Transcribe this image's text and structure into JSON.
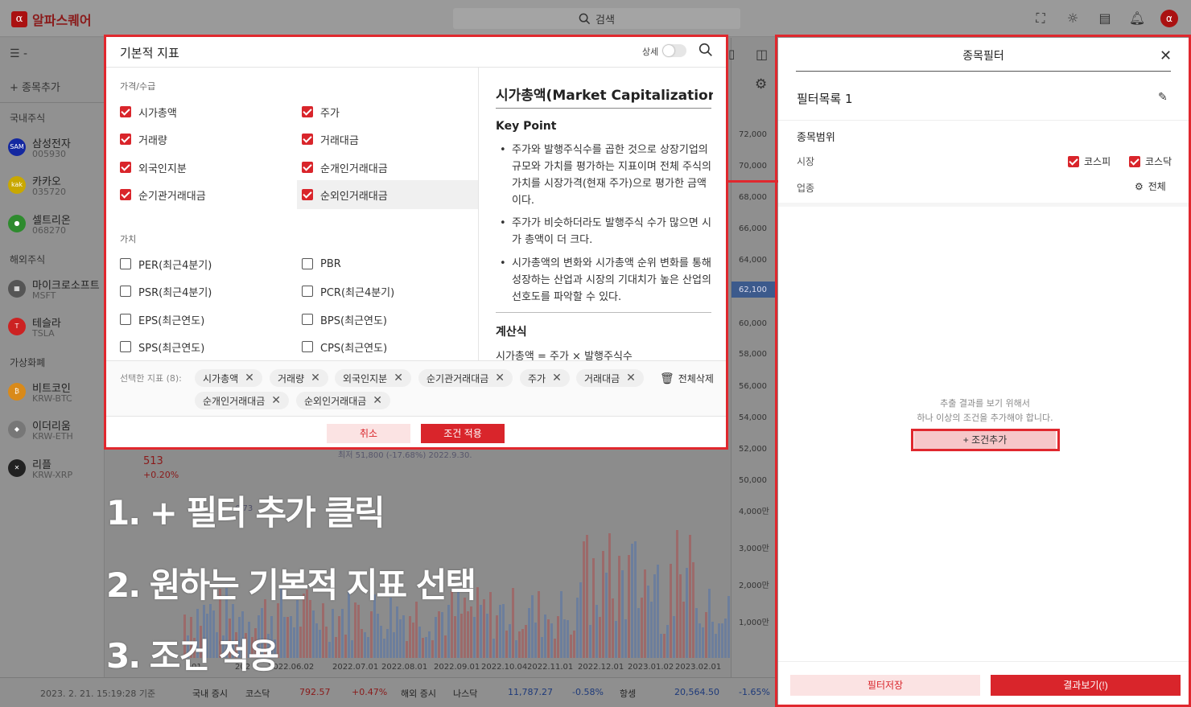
{
  "app": {
    "name": "알파스퀘어",
    "logo_letter": "α",
    "search_placeholder": "검색"
  },
  "colors": {
    "accent": "#d9252b",
    "highlight_frame": "#e0282e"
  },
  "sidebar": {
    "menu_label": "☰ -",
    "add_label": "+ 종목추가",
    "sections": [
      "국내주식",
      "해외주식",
      "가상화폐"
    ],
    "stocks": [
      {
        "name": "삼성전자",
        "code": "005930",
        "icon": "samsung-icon",
        "color": "#1428a0"
      },
      {
        "name": "카카오",
        "code": "035720",
        "icon": "kakao-icon",
        "color": "#c9a800"
      },
      {
        "name": "셀트리온",
        "code": "068270",
        "icon": "celltrion-icon",
        "color": "#2e8b2e"
      },
      {
        "name": "마이크로소프트",
        "code": "MSFT",
        "icon": "microsoft-icon",
        "color": "#555"
      },
      {
        "name": "테슬라",
        "code": "TSLA",
        "icon": "tesla-icon",
        "color": "#c22"
      },
      {
        "name": "비트코인",
        "code": "KRW-BTC",
        "icon": "bitcoin-icon",
        "color": "#d98a1a"
      },
      {
        "name": "이더리움",
        "code": "KRW-ETH",
        "icon": "ethereum-icon",
        "color": "#777"
      },
      {
        "name": "리플",
        "code": "KRW-XRP",
        "icon": "ripple-icon",
        "color": "#222"
      }
    ],
    "ripple_price": "513",
    "ripple_change": "+0.20%"
  },
  "chart": {
    "yticks": [
      "72,000",
      "70,000",
      "68,000",
      "66,000",
      "64,000",
      "62,100",
      "60,000",
      "58,000",
      "56,000",
      "54,000",
      "52,000",
      "50,000",
      "4,000만",
      "3,000만",
      "2,000만",
      "1,000만"
    ],
    "xticks": [
      "01",
      "202",
      "2022.06.02",
      "2022.07.01",
      "2022.08.01",
      "2022.09.01",
      "2022.10.04",
      "2022.11.01",
      "2022.12.01",
      "2023.01.02",
      "2023.02.01"
    ],
    "annot1": "최저 51,800 (-17.68%) 2022.9.30.",
    "annot2": "6,73"
  },
  "ticker": {
    "time": "2023. 2. 21. 15:19:28 기준",
    "domestic": "국내 증시",
    "kosdaq": "코스닥",
    "kosdaq_val": "792.57",
    "kosdaq_chg": "+0.47%",
    "foreign": "해외 증시",
    "nasdaq": "나스닥",
    "nasdaq_val": "11,787.27",
    "nasdaq_chg": "-0.58%",
    "hangseng": "항셍",
    "hangseng_val": "20,564.50",
    "hangseng_chg": "-1.65%"
  },
  "steps": [
    "1. + 필터 추가 클릭",
    "2. 원하는 기본적 지표 선택",
    "3. 조건 적용"
  ],
  "modal": {
    "title": "기본적 지표",
    "detail_label": "상세",
    "sec_price": "가격/수급",
    "sec_value": "가치",
    "price_items": [
      {
        "label": "시가총액",
        "checked": true
      },
      {
        "label": "주가",
        "checked": true
      },
      {
        "label": "거래량",
        "checked": true
      },
      {
        "label": "거래대금",
        "checked": true
      },
      {
        "label": "외국인지분",
        "checked": true
      },
      {
        "label": "순개인거래대금",
        "checked": true
      },
      {
        "label": "순기관거래대금",
        "checked": true
      },
      {
        "label": "순외인거래대금",
        "checked": true
      }
    ],
    "value_items": [
      {
        "label": "PER(최근4분기)",
        "checked": false
      },
      {
        "label": "PBR",
        "checked": false
      },
      {
        "label": "PSR(최근4분기)",
        "checked": false
      },
      {
        "label": "PCR(최근4분기)",
        "checked": false
      },
      {
        "label": "EPS(최근연도)",
        "checked": false
      },
      {
        "label": "BPS(최근연도)",
        "checked": false
      },
      {
        "label": "SPS(최근연도)",
        "checked": false
      },
      {
        "label": "CPS(최근연도)",
        "checked": false
      }
    ],
    "info": {
      "title": "시가총액(Market Capitalization)",
      "keypoint": "Key Point",
      "b1": "주가와 발행주식수를 곱한 것으로 상장기업의 규모와 가치를 평가하는 지표이며 전체 주식의 가치를 시장가격(현재 주가)으로 평가한 금액이다.",
      "b2": "주가가 비슷하더라도 발행주식 수가 많으면 시가 총액이 더 크다.",
      "b3": "시가총액의 변화와 시가총액 순위 변화를 통해 성장하는 산업과 시장의 기대치가 높은 산업의 선호도를 파악할 수 있다.",
      "calc_title": "계산식",
      "calc_formula": "시가총액 = 주가 × 발행주식수"
    },
    "selected_label": "선택한 지표 (8):",
    "selected": [
      "시가총액",
      "거래량",
      "외국인지분",
      "순기관거래대금",
      "주가",
      "거래대금",
      "순개인거래대금",
      "순외인거래대금"
    ],
    "delete_all": "전체삭제",
    "cancel": "취소",
    "apply": "조건 적용"
  },
  "filter_panel": {
    "title": "종목필터",
    "list_name": "필터목록 1",
    "scope": "종목범위",
    "market": "시장",
    "industry": "업종",
    "kospi": "코스피",
    "kosdaq": "코스닥",
    "all": "전체",
    "empty1": "추출 결과를 보기 위해서",
    "empty2": "하나 이상의 조건을 추가해야 합니다.",
    "add_condition": "+ 조건추가",
    "save": "필터저장",
    "result": "결과보기(!)"
  }
}
